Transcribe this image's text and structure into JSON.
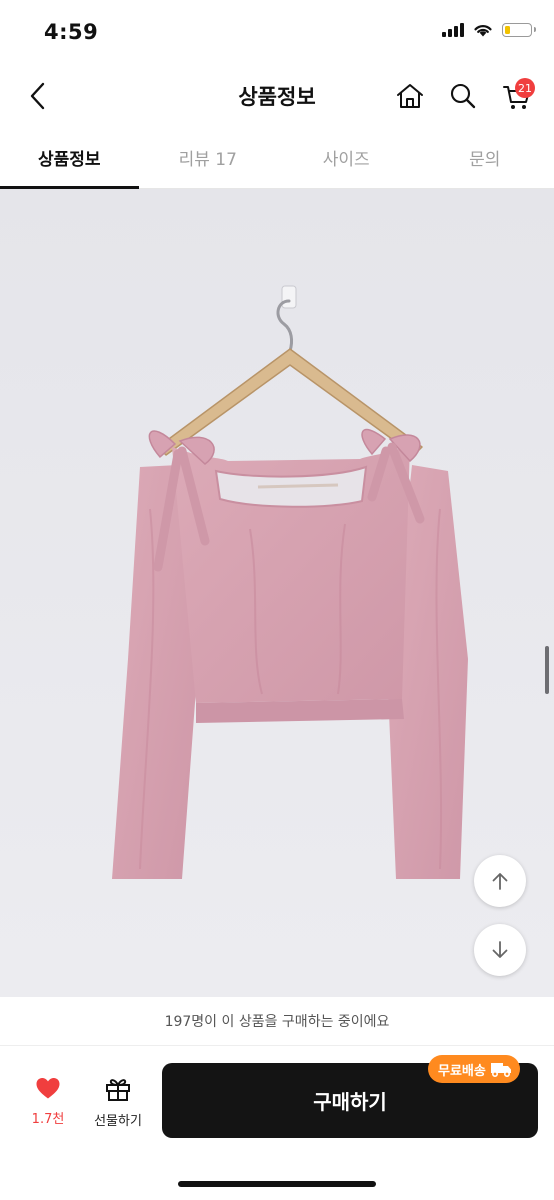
{
  "status": {
    "time": "4:59",
    "icons": [
      "signal-icon",
      "wifi-icon",
      "battery-low-icon"
    ]
  },
  "header": {
    "title": "상품정보",
    "cart_count": "21",
    "icons": [
      "back-chevron-icon",
      "home-icon",
      "search-icon",
      "cart-icon"
    ]
  },
  "tabs": [
    {
      "label": "상품정보",
      "active": true
    },
    {
      "label": "리뷰 17",
      "active": false
    },
    {
      "label": "사이즈",
      "active": false
    },
    {
      "label": "문의",
      "active": false
    }
  ],
  "product_image": {
    "subject": "pink off-shoulder crop top with shoulder ties on a wooden hanger"
  },
  "floating_buttons": [
    "arrow-up-icon",
    "arrow-down-icon"
  ],
  "notice": "197명이 이 상품을 구매하는 중이에요",
  "bottom_bar": {
    "like_count": "1.7천",
    "gift_label": "선물하기",
    "buy_label": "구매하기",
    "shipping_badge": "무료배송"
  },
  "colors": {
    "accent_red": "#f03e3e",
    "buy_button": "#141414",
    "shipping_orange": "#ff8a1f",
    "product_pink": "#d9a3b1",
    "wall_gray": "#e8e8ec"
  }
}
